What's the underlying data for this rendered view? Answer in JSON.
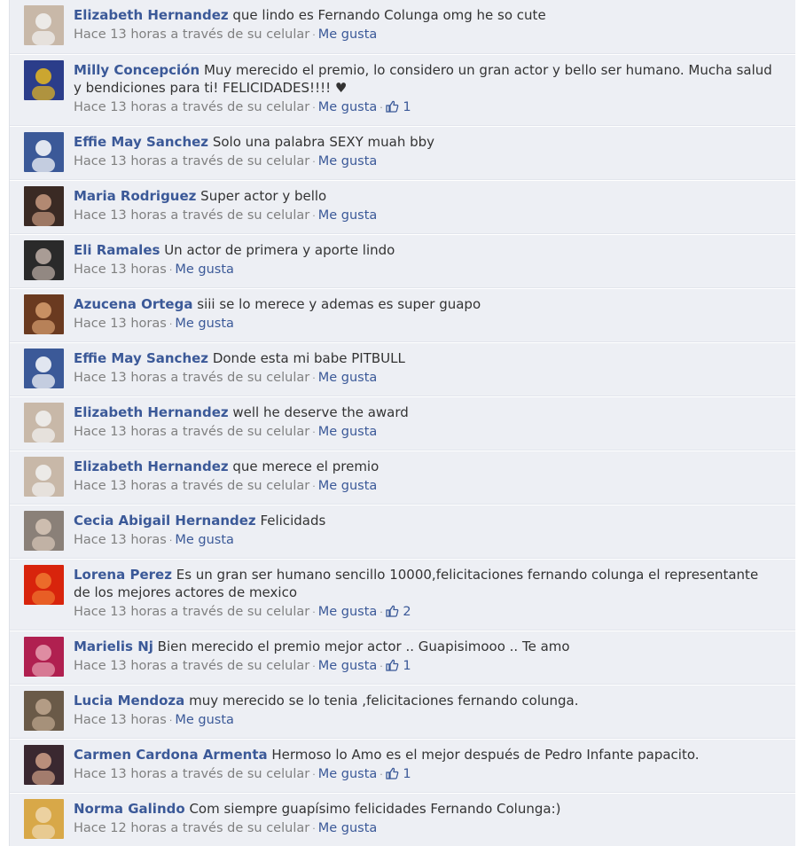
{
  "comments": [
    {
      "name": "Elizabeth Hernandez",
      "text": "que lindo es Fernando Colunga omg he so cute",
      "time": "Hace 13 horas a través de su celular",
      "like": "Me gusta",
      "likes": "",
      "avatar": {
        "bg": "#c8b8a8",
        "fg": "#f2f2f2"
      }
    },
    {
      "name": "Milly Concepción",
      "text": "Muy merecido el premio, lo considero un gran actor y bello ser humano. Mucha salud y bendiciones para ti! FELICIDADES!!!! ♥",
      "time": "Hace 13 horas a través de su celular",
      "like": "Me gusta",
      "likes": "1",
      "avatar": {
        "bg": "#2b3d8a",
        "fg": "#e8b820"
      }
    },
    {
      "name": "Effie May Sanchez",
      "text": "Solo una palabra SEXY muah bby",
      "time": "Hace 13 horas a través de su celular",
      "like": "Me gusta",
      "likes": "",
      "avatar": {
        "bg": "#3b5998",
        "fg": "#ffffff"
      }
    },
    {
      "name": "Maria Rodriguez",
      "text": "Super actor y bello",
      "time": "Hace 13 horas a través de su celular",
      "like": "Me gusta",
      "likes": "",
      "avatar": {
        "bg": "#3a2a24",
        "fg": "#c89a80"
      }
    },
    {
      "name": "Eli Ramales",
      "text": "Un actor de primera y aporte lindo",
      "time": "Hace 13 horas",
      "like": "Me gusta",
      "likes": "",
      "avatar": {
        "bg": "#2a2a2a",
        "fg": "#bfb0a8"
      }
    },
    {
      "name": "Azucena Ortega",
      "text": "siii se lo merece y ademas es super guapo",
      "time": "Hace 13 horas",
      "like": "Me gusta",
      "likes": "",
      "avatar": {
        "bg": "#6a3a20",
        "fg": "#d8a070"
      }
    },
    {
      "name": "Effie May Sanchez",
      "text": "Donde esta mi babe PITBULL",
      "time": "Hace 13 horas a través de su celular",
      "like": "Me gusta",
      "likes": "",
      "avatar": {
        "bg": "#3b5998",
        "fg": "#ffffff"
      }
    },
    {
      "name": "Elizabeth Hernandez",
      "text": "well he deserve the award",
      "time": "Hace 13 horas a través de su celular",
      "like": "Me gusta",
      "likes": "",
      "avatar": {
        "bg": "#c8b8a8",
        "fg": "#f2f2f2"
      }
    },
    {
      "name": "Elizabeth Hernandez",
      "text": "que merece el premio",
      "time": "Hace 13 horas a través de su celular",
      "like": "Me gusta",
      "likes": "",
      "avatar": {
        "bg": "#c8b8a8",
        "fg": "#f2f2f2"
      }
    },
    {
      "name": "Cecia Abigail Hernandez",
      "text": "Felicidads",
      "time": "Hace 13 horas",
      "like": "Me gusta",
      "likes": "",
      "avatar": {
        "bg": "#8a8078",
        "fg": "#d8c8b8"
      }
    },
    {
      "name": "Lorena Perez",
      "text": "Es un gran ser humano sencillo 10000,felicitaciones fernando colunga el representante de los mejores actores de mexico",
      "time": "Hace 13 horas a través de su celular",
      "like": "Me gusta",
      "likes": "2",
      "avatar": {
        "bg": "#d8240c",
        "fg": "#f07830"
      }
    },
    {
      "name": "Marielis Nj",
      "text": "Bien merecido el premio mejor actor .. Guapisimooo .. Te amo",
      "time": "Hace 13 horas a través de su celular",
      "like": "Me gusta",
      "likes": "1",
      "avatar": {
        "bg": "#b02050",
        "fg": "#e8a0b0"
      }
    },
    {
      "name": "Lucia Mendoza",
      "text": "muy merecido se lo tenia ,felicitaciones fernando colunga.",
      "time": "Hace 13 horas",
      "like": "Me gusta",
      "likes": "",
      "avatar": {
        "bg": "#6a5a48",
        "fg": "#c0a890"
      }
    },
    {
      "name": "Carmen Cardona Armenta",
      "text": "Hermoso lo Amo es el mejor después de Pedro Infante papacito.",
      "time": "Hace 13 horas a través de su celular",
      "like": "Me gusta",
      "likes": "1",
      "avatar": {
        "bg": "#3a2830",
        "fg": "#d0a088"
      }
    },
    {
      "name": "Norma Galindo",
      "text": "Com siempre guapísimo felicidades Fernando Colunga:)",
      "time": "Hace 12 horas a través de su celular",
      "like": "Me gusta",
      "likes": "",
      "avatar": {
        "bg": "#d8a848",
        "fg": "#f0d8b0"
      }
    }
  ],
  "dot": "·",
  "icons": {
    "like_count": "thumbs-up-icon"
  }
}
